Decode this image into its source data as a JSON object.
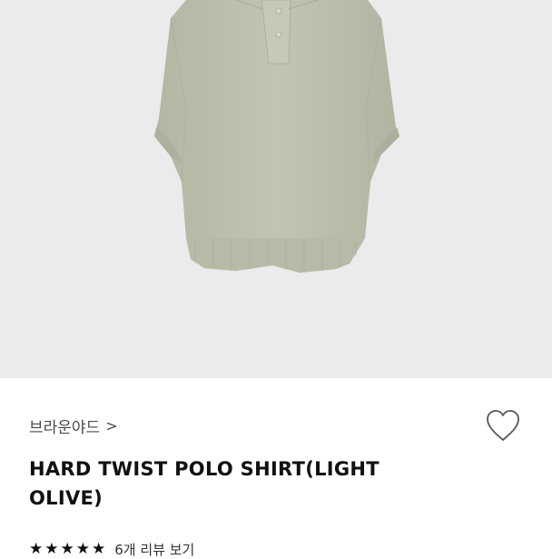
{
  "product": {
    "brand": "브라운야드",
    "brand_chevron": ">",
    "title": "HARD TWIST POLO SHIRT(LIGHT OLIVE)",
    "image_subject": "light olive polo shirt",
    "image_bg_color": "#ebebeb",
    "garment_color": "#bdbfad"
  },
  "rating": {
    "stars": 5,
    "star_glyph": "★",
    "review_link": "6개 리뷰 보기"
  },
  "icons": {
    "wishlist": "heart-outline-icon"
  }
}
